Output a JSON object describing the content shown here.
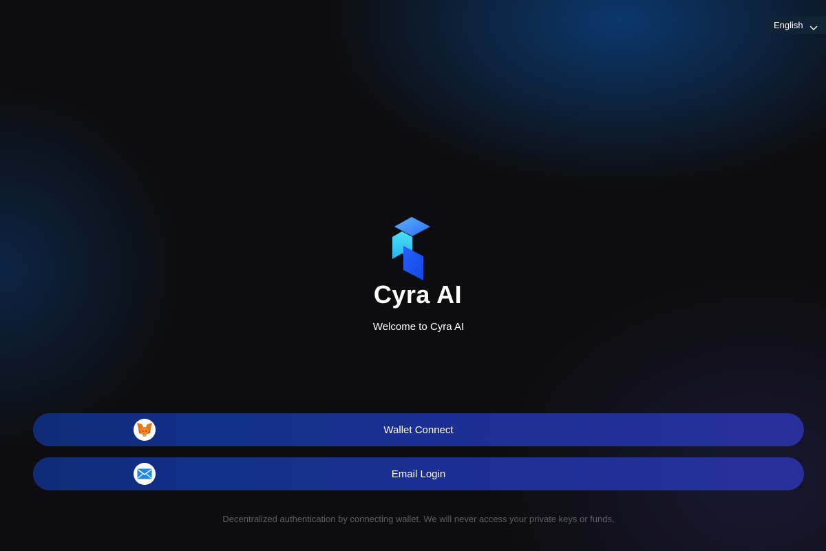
{
  "language": {
    "selected": "English",
    "icon": "chevron-down-icon"
  },
  "brand": {
    "name": "Cyra AI",
    "logo_icon": "cyra-logo-icon",
    "colors": {
      "cyan": "#3cd0f0",
      "blue": "#1a56f5",
      "light_blue": "#4a9cf5"
    }
  },
  "welcome_text": "Welcome to Cyra AI",
  "buttons": {
    "wallet": {
      "label": "Wallet Connect",
      "icon": "metamask-fox-icon"
    },
    "email": {
      "label": "Email Login",
      "icon": "envelope-icon"
    }
  },
  "disclaimer": "Decentralized authentication by connecting wallet. We will never access your private keys or funds."
}
